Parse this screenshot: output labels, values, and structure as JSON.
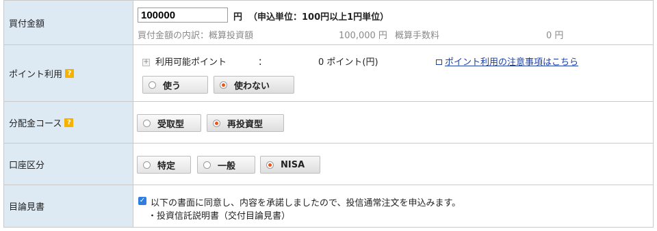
{
  "purchase_amount": {
    "label": "買付金額",
    "value": "100000",
    "unit": "円",
    "note": "（申込単位：100円以上1円単位）",
    "breakdown_label": "買付金額の内訳：概算投資額",
    "investment_amount": "100,000 円",
    "fee_label": "概算手数料",
    "fee_amount": "0 円"
  },
  "points": {
    "label": "ポイント利用",
    "help": "?",
    "available_label": "利用可能ポイント",
    "colon": "：",
    "available_value": "0 ポイント(円)",
    "notice_link": "ポイント利用の注意事項はこちら",
    "options": [
      "使う",
      "使わない"
    ],
    "selected": "使わない"
  },
  "distribution": {
    "label": "分配金コース",
    "help": "?",
    "options": [
      "受取型",
      "再投資型"
    ],
    "selected": "再投資型"
  },
  "account": {
    "label": "口座区分",
    "options": [
      "特定",
      "一般",
      "NISA"
    ],
    "selected": "NISA"
  },
  "prospectus": {
    "label": "目論見書",
    "agree_text": "以下の書面に同意し、内容を承諾しましたので、投信通常注文を申込みます。",
    "document_item": "・投資信託説明書（交付目論見書）",
    "checked": true
  },
  "colors": {
    "label_bg": "#dde9f3",
    "border": "#c9c9c9",
    "radio_selected": "#e8541a",
    "link": "#1a3fa6",
    "checkbox": "#2f7de1",
    "help_badge": "#f5b200"
  }
}
